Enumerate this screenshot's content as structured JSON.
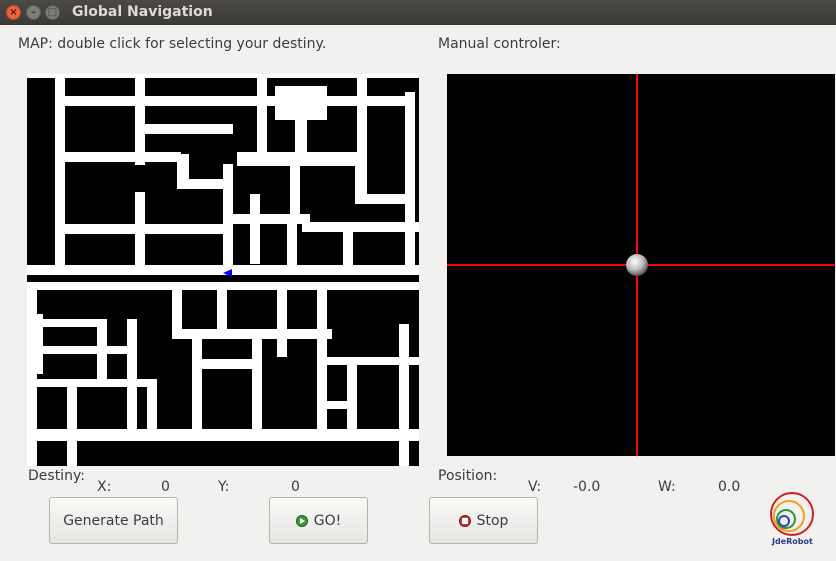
{
  "window": {
    "title": "Global Navigation"
  },
  "map": {
    "label": "MAP: double click for selecting your destiny."
  },
  "controller": {
    "label": "Manual controler:"
  },
  "destiny": {
    "label": "Destiny:",
    "x_label": "X:",
    "x_value": "0",
    "y_label": "Y:",
    "y_value": "0"
  },
  "position": {
    "label": "Position:",
    "v_label": "V:",
    "v_value": "-0.0",
    "w_label": "W:",
    "w_value": "0.0"
  },
  "buttons": {
    "generate": "Generate Path",
    "go": "GO!",
    "stop": "Stop"
  },
  "logo": {
    "text": "JdeRobot"
  },
  "colors": {
    "crosshair": "#ff0000",
    "robot_marker": "#0000ff",
    "map_roads": "#ffffff",
    "map_background": "#000000"
  }
}
